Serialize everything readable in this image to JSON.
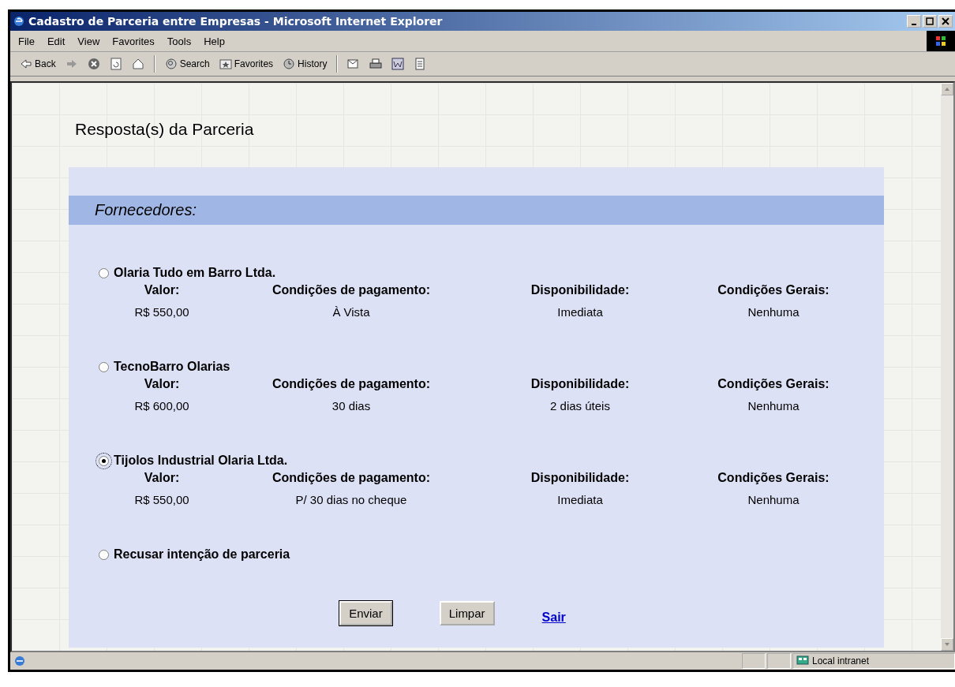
{
  "window": {
    "title": "Cadastro de Parceria entre Empresas - Microsoft Internet Explorer"
  },
  "menu": [
    "File",
    "Edit",
    "View",
    "Favorites",
    "Tools",
    "Help"
  ],
  "toolbar": [
    {
      "kind": "back",
      "label": "Back"
    },
    {
      "kind": "forward"
    },
    {
      "kind": "stop"
    },
    {
      "kind": "refresh"
    },
    {
      "kind": "home"
    },
    {
      "kind": "sep"
    },
    {
      "kind": "search",
      "label": "Search"
    },
    {
      "kind": "favorites",
      "label": "Favorites"
    },
    {
      "kind": "history",
      "label": "History"
    },
    {
      "kind": "sep"
    },
    {
      "kind": "mail"
    },
    {
      "kind": "print"
    },
    {
      "kind": "edit"
    },
    {
      "kind": "discuss"
    }
  ],
  "page": {
    "heading": "Resposta(s) da Parceria",
    "section": "Fornecedores:",
    "options": [
      {
        "kind": "supplier",
        "name": "Olaria Tudo em Barro Ltda.",
        "selected": false,
        "fields": [
          {
            "label": "Valor:",
            "value": "R$ 550,00"
          },
          {
            "label": "Condições de pagamento:",
            "value": "À Vista"
          },
          {
            "label": "Disponibilidade:",
            "value": "Imediata"
          },
          {
            "label": "Condições Gerais:",
            "value": "Nenhuma"
          }
        ]
      },
      {
        "kind": "supplier",
        "name": "TecnoBarro Olarias",
        "selected": false,
        "fields": [
          {
            "label": "Valor:",
            "value": "R$ 600,00"
          },
          {
            "label": "Condições de pagamento:",
            "value": "30 dias"
          },
          {
            "label": "Disponibilidade:",
            "value": "2 dias úteis"
          },
          {
            "label": "Condições Gerais:",
            "value": "Nenhuma"
          }
        ]
      },
      {
        "kind": "supplier",
        "name": "Tijolos Industrial Olaria Ltda.",
        "selected": true,
        "fields": [
          {
            "label": "Valor:",
            "value": "R$ 550,00"
          },
          {
            "label": "Condições de pagamento:",
            "value": "P/ 30 dias no cheque"
          },
          {
            "label": "Disponibilidade:",
            "value": "Imediata"
          },
          {
            "label": "Condições Gerais:",
            "value": "Nenhuma"
          }
        ]
      },
      {
        "kind": "refuse",
        "name": "Recusar intenção de parceria",
        "selected": false
      }
    ],
    "buttons": [
      "Enviar",
      "Limpar"
    ],
    "link": "Sair"
  },
  "status_bar": {
    "zone": "Local intranet"
  }
}
